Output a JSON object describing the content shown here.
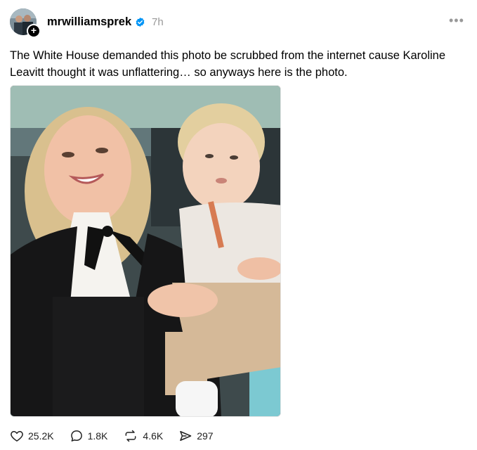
{
  "post": {
    "author": "mrwilliamsprek",
    "time": "7h",
    "more_label": "•••",
    "follow_glyph": "+",
    "caption": "The White House demanded this photo be scrubbed from the internet cause Karoline Leavitt thought it was unflattering… so anyways here is the photo.",
    "verified_color": "#0095f6"
  },
  "actions": {
    "likes": "25.2K",
    "replies": "1.8K",
    "reposts": "4.6K",
    "shares": "297"
  },
  "icons": {
    "like": "heart-icon",
    "reply": "speech-bubble-icon",
    "repost": "repost-icon",
    "share": "send-icon",
    "verified": "verified-badge-icon",
    "more": "more-icon"
  }
}
